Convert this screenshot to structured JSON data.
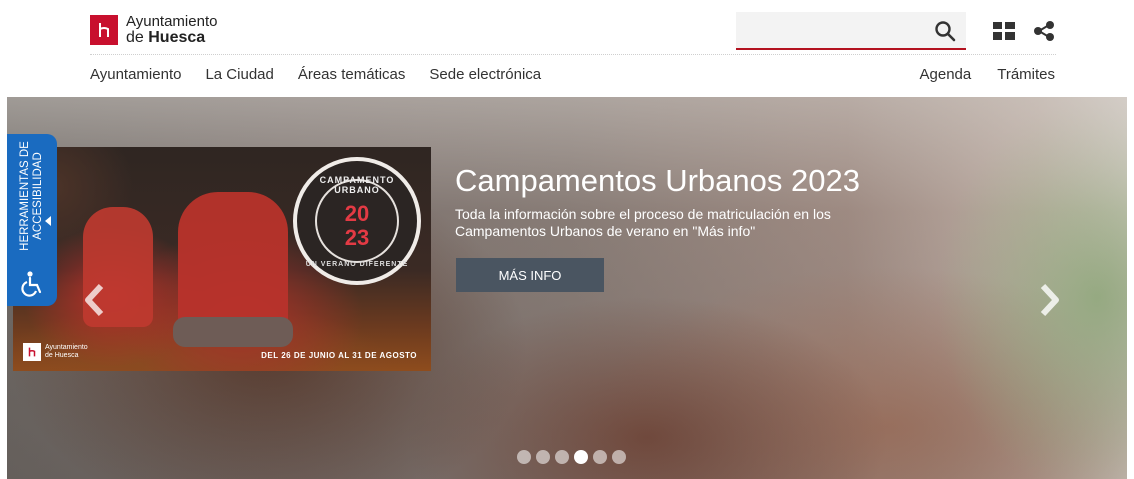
{
  "header": {
    "logo_line1": "Ayuntamiento",
    "logo_line2_prefix": "de",
    "logo_line2_bold": "Huesca",
    "search": {
      "placeholder": "",
      "icon": "search-icon"
    },
    "icons": [
      "grid-icon",
      "share-icon"
    ]
  },
  "nav": {
    "left": [
      "Ayuntamiento",
      "La Ciudad",
      "Áreas temáticas",
      "Sede electrónica"
    ],
    "right": [
      "Agenda",
      "Trámites"
    ]
  },
  "accessibility": {
    "line1": "HERRAMIENTAS DE",
    "line2": "ACCESIBILIDAD",
    "icon": "wheelchair-icon"
  },
  "hero": {
    "title": "Campamentos Urbanos 2023",
    "text": "Toda la información sobre el proceso de matriculación en los Campamentos Urbanos de verano en \"Más info\"",
    "button": "MÁS INFO",
    "image": {
      "badge_top": "CAMPAMENTO URBANO",
      "badge_year_1": "20",
      "badge_year_2": "23",
      "badge_bottom": "UN VERANO DIFERENTE",
      "logo_line1": "Ayuntamiento",
      "logo_line2": "de Huesca",
      "dates": "DEL 26 DE JUNIO AL 31 DE AGOSTO"
    },
    "slides_count": 6,
    "active_slide_index": 3
  },
  "colors": {
    "brand_red": "#c8102e",
    "accessibility_blue": "#1a6bc0",
    "button_gray": "#4a5561"
  }
}
